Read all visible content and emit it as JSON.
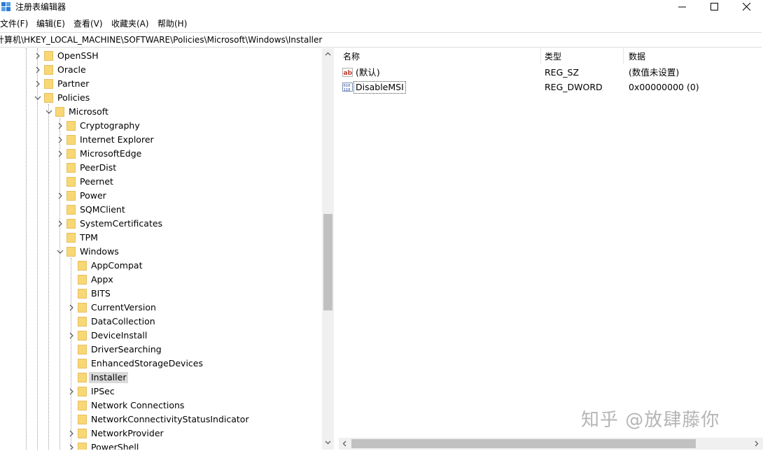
{
  "window": {
    "title": "注册表编辑器"
  },
  "menu": [
    "文件(F)",
    "编辑(E)",
    "查看(V)",
    "收藏夹(A)",
    "帮助(H)"
  ],
  "address": "计算机\\HKEY_LOCAL_MACHINE\\SOFTWARE\\Policies\\Microsoft\\Windows\\Installer",
  "tree": [
    {
      "label": "OpenSSH",
      "expander": "collapsed",
      "level": 0
    },
    {
      "label": "Oracle",
      "expander": "collapsed",
      "level": 0
    },
    {
      "label": "Partner",
      "expander": "collapsed",
      "level": 0
    },
    {
      "label": "Policies",
      "expander": "expanded",
      "level": 0
    },
    {
      "label": "Microsoft",
      "expander": "expanded",
      "level": 1
    },
    {
      "label": "Cryptography",
      "expander": "collapsed",
      "level": 2
    },
    {
      "label": "Internet Explorer",
      "expander": "collapsed",
      "level": 2
    },
    {
      "label": "MicrosoftEdge",
      "expander": "collapsed",
      "level": 2
    },
    {
      "label": "PeerDist",
      "expander": "none",
      "level": 2
    },
    {
      "label": "Peernet",
      "expander": "none",
      "level": 2
    },
    {
      "label": "Power",
      "expander": "collapsed",
      "level": 2
    },
    {
      "label": "SQMClient",
      "expander": "none",
      "level": 2
    },
    {
      "label": "SystemCertificates",
      "expander": "collapsed",
      "level": 2
    },
    {
      "label": "TPM",
      "expander": "none",
      "level": 2
    },
    {
      "label": "Windows",
      "expander": "expanded",
      "level": 2
    },
    {
      "label": "AppCompat",
      "expander": "none",
      "level": 3
    },
    {
      "label": "Appx",
      "expander": "none",
      "level": 3
    },
    {
      "label": "BITS",
      "expander": "none",
      "level": 3
    },
    {
      "label": "CurrentVersion",
      "expander": "collapsed",
      "level": 3
    },
    {
      "label": "DataCollection",
      "expander": "none",
      "level": 3
    },
    {
      "label": "DeviceInstall",
      "expander": "collapsed",
      "level": 3
    },
    {
      "label": "DriverSearching",
      "expander": "none",
      "level": 3
    },
    {
      "label": "EnhancedStorageDevices",
      "expander": "none",
      "level": 3
    },
    {
      "label": "Installer",
      "expander": "none",
      "level": 3,
      "selected": true
    },
    {
      "label": "IPSec",
      "expander": "collapsed",
      "level": 3
    },
    {
      "label": "Network Connections",
      "expander": "none",
      "level": 3
    },
    {
      "label": "NetworkConnectivityStatusIndicator",
      "expander": "none",
      "level": 3
    },
    {
      "label": "NetworkProvider",
      "expander": "collapsed",
      "level": 3
    },
    {
      "label": "PowerShell",
      "expander": "collapsed",
      "level": 3
    }
  ],
  "columns": {
    "name": "名称",
    "type": "类型",
    "data": "数据"
  },
  "values": [
    {
      "icon": "string-value-icon",
      "name": "(默认)",
      "type": "REG_SZ",
      "data": "(数值未设置)"
    },
    {
      "icon": "dword-value-icon",
      "name": "DisableMSI",
      "type": "REG_DWORD",
      "data": "0x00000000 (0)",
      "focused": true
    }
  ],
  "watermark": "知乎 @放肆藤你",
  "colors": {
    "folder": "#f8d775",
    "folder_edge": "#e0b44a",
    "selection": "#d9d9d9",
    "scrollbar_thumb": "#c1c1c1"
  }
}
